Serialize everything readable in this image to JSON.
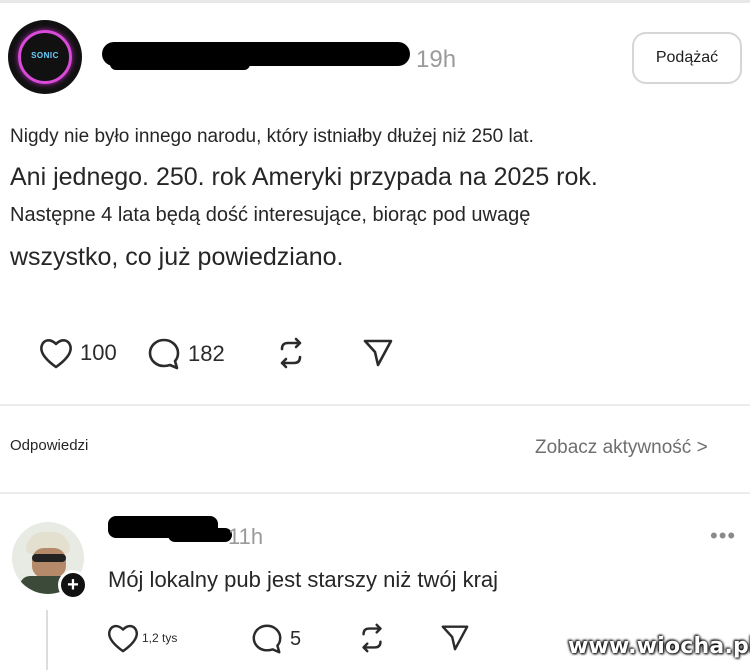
{
  "post": {
    "time": "19h",
    "follow_label": "Podążać",
    "avatar_logo_text": "SONIC",
    "lines": [
      "Nigdy nie było innego narodu, który istniałby dłużej niż 250 lat.",
      "Ani jednego. 250. rok Ameryki przypada na 2025 rok.",
      "Następne 4 lata będą dość interesujące, biorąc pod uwagę",
      "wszystko, co już powiedziano."
    ],
    "actions": {
      "likes": "100",
      "comments": "182"
    }
  },
  "replies_section": {
    "title": "Odpowiedzi",
    "activity_link": "Zobacz aktywność >"
  },
  "reply": {
    "time": "11h",
    "more": "•••",
    "text": "Mój lokalny pub jest starszy niż twój kraj",
    "actions": {
      "likes": "1,2 tys",
      "comments": "5"
    }
  },
  "watermark": "www.wiocha.pl",
  "icons": {
    "like": "heart-icon",
    "comment": "comment-bubble-icon",
    "repost": "repost-icon",
    "share": "send-icon"
  }
}
